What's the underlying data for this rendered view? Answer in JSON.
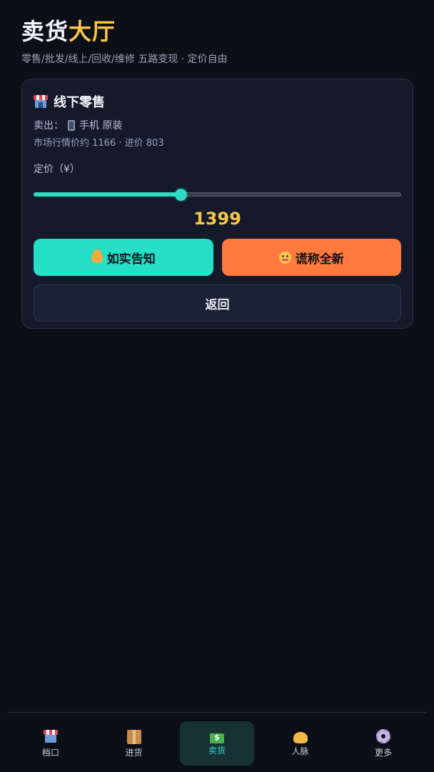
{
  "header": {
    "title_part1": "卖货",
    "title_part2": "大厅",
    "subtitle": "零售/批发/线上/回收/维修 五路变现 · 定价自由"
  },
  "card": {
    "title": "线下零售",
    "sell_prefix": "卖出：",
    "item_name": "手机 原装",
    "market_info": "市场行情价约 1166 · 进价 803",
    "price_label": "定价（¥）",
    "price_value": "1399",
    "slider_fraction": 0.4,
    "honest_button": "如实告知",
    "lie_button": "谎称全新",
    "back_button": "返回"
  },
  "nav": [
    {
      "label": "档口",
      "icon": "store-icon",
      "active": false
    },
    {
      "label": "进货",
      "icon": "box-icon",
      "active": false
    },
    {
      "label": "卖货",
      "icon": "money-icon",
      "active": true
    },
    {
      "label": "人脉",
      "icon": "handshake-icon",
      "active": false
    },
    {
      "label": "更多",
      "icon": "gear-icon",
      "active": false
    }
  ],
  "colors": {
    "accent": "#2edbc4",
    "price": "#f7c548",
    "lie": "#ff7b3d",
    "background": "#0c0f18"
  }
}
